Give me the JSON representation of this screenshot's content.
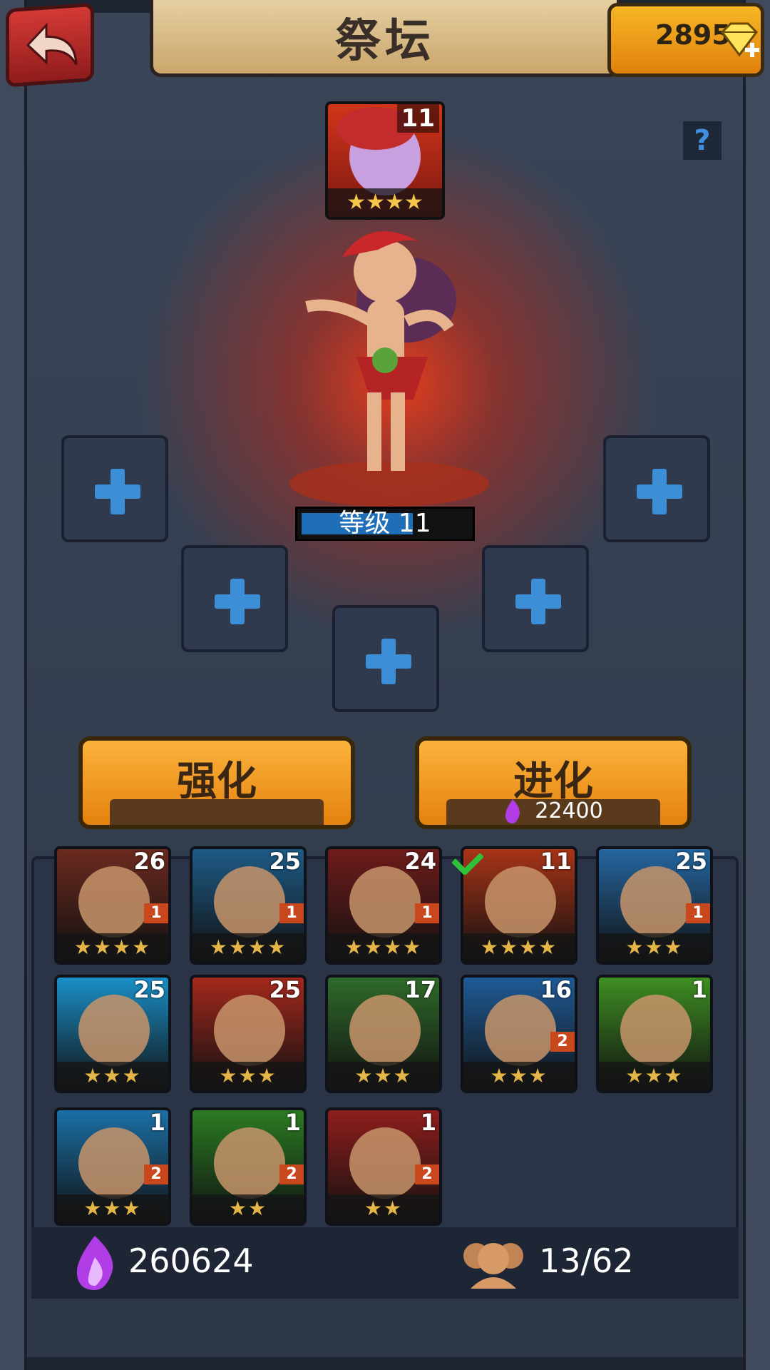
{
  "header": {
    "title": "祭坛",
    "gems": "2895"
  },
  "help_label": "?",
  "selected_hero": {
    "level": "11",
    "stars": "★★★★",
    "level_label": "等级 11",
    "level_progress": 0.65
  },
  "buttons": {
    "enhance": "强化",
    "evolve": "进化",
    "evolve_cost": "22400"
  },
  "heroes": [
    {
      "level": "26",
      "badge": "1",
      "stars": "★★★★",
      "color": "#6b2a1f"
    },
    {
      "level": "25",
      "badge": "1",
      "stars": "★★★★",
      "color": "#1d5b86"
    },
    {
      "level": "24",
      "badge": "1",
      "stars": "★★★★",
      "color": "#6e1c1a"
    },
    {
      "level": "11",
      "badge": "",
      "stars": "★★★★",
      "color": "#a83417"
    },
    {
      "level": "25",
      "badge": "1",
      "stars": "★★★",
      "color": "#2566a0"
    },
    {
      "level": "25",
      "badge": "",
      "stars": "★★★",
      "color": "#1a8fc7"
    },
    {
      "level": "25",
      "badge": "",
      "stars": "★★★",
      "color": "#a3281c"
    },
    {
      "level": "17",
      "badge": "",
      "stars": "★★★",
      "color": "#2f6a2a"
    },
    {
      "level": "16",
      "badge": "2",
      "stars": "★★★",
      "color": "#1f5b97"
    },
    {
      "level": "1",
      "badge": "",
      "stars": "★★★",
      "color": "#3e8e22"
    },
    {
      "level": "1",
      "badge": "2",
      "stars": "★★★",
      "color": "#1b6fa6"
    },
    {
      "level": "1",
      "badge": "2",
      "stars": "★★",
      "color": "#2b7b23"
    },
    {
      "level": "1",
      "badge": "2",
      "stars": "★★",
      "color": "#8e1e1c"
    }
  ],
  "footer": {
    "essence": "260624",
    "roster": "13/62"
  }
}
